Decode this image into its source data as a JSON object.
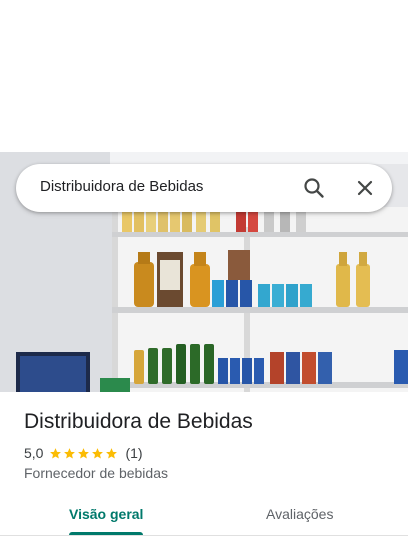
{
  "search": {
    "query": "Distribuidora de Bebidas",
    "search_icon": "magnify-icon",
    "close_icon": "close-icon"
  },
  "place": {
    "name": "Distribuidora de Bebidas",
    "rating": "5,0",
    "stars": 5,
    "review_count": "(1)",
    "category": "Fornecedor de bebidas"
  },
  "tabs": [
    {
      "label": "Visão geral",
      "active": true
    },
    {
      "label": "Avaliações",
      "active": false
    }
  ],
  "colors": {
    "accent": "#00796b",
    "star": "#fbbc04"
  }
}
